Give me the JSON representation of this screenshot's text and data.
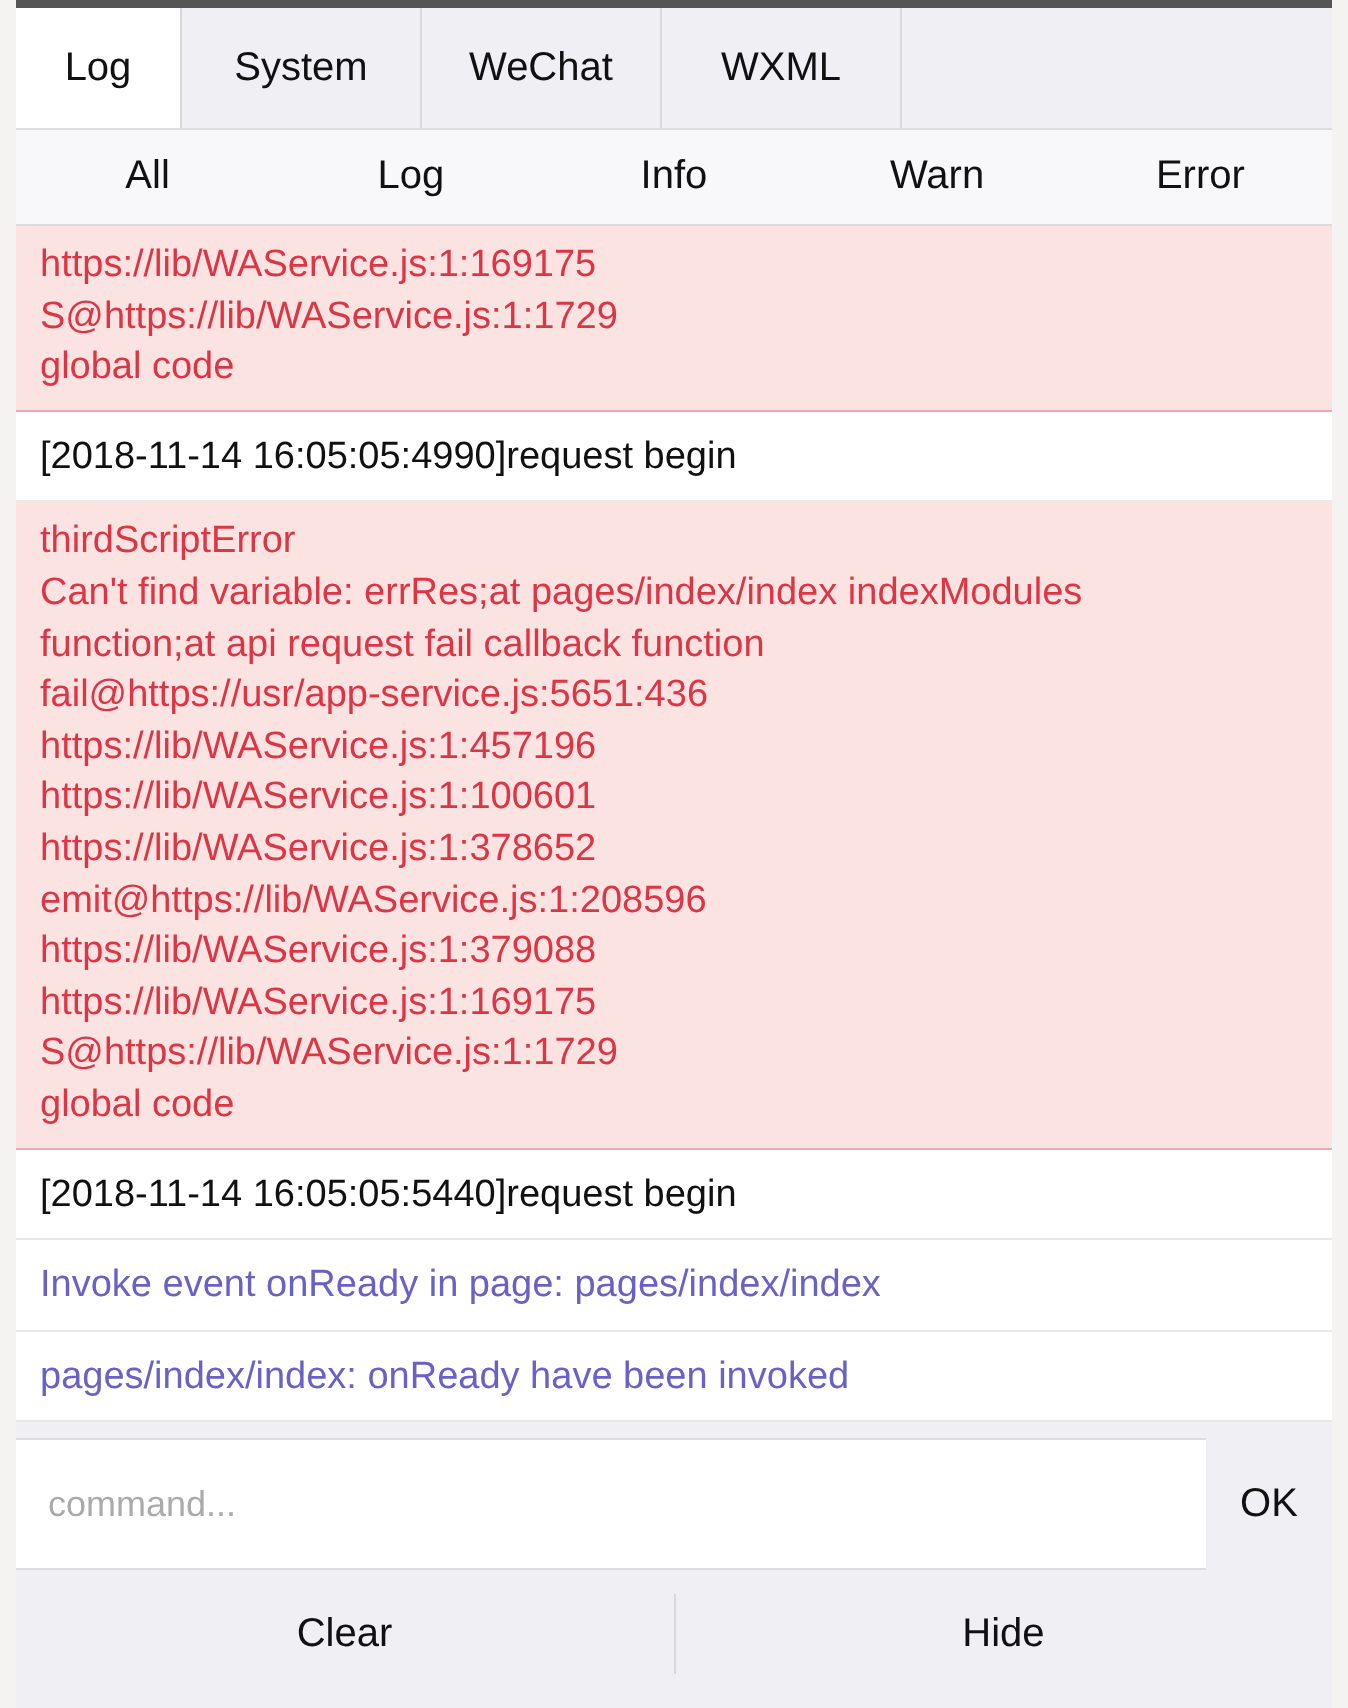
{
  "tabs": [
    {
      "label": "Log",
      "selected": true
    },
    {
      "label": "System",
      "selected": false
    },
    {
      "label": "WeChat",
      "selected": false
    },
    {
      "label": "WXML",
      "selected": false
    }
  ],
  "filters": [
    {
      "label": "All"
    },
    {
      "label": "Log"
    },
    {
      "label": "Info"
    },
    {
      "label": "Warn"
    },
    {
      "label": "Error"
    }
  ],
  "entries": [
    {
      "kind": "error",
      "lines": [
        "https://lib/WAService.js:1:169175",
        "S@https://lib/WAService.js:1:1729",
        "global code"
      ]
    },
    {
      "kind": "log",
      "lines": [
        "[2018-11-14 16:05:05:4990]request begin"
      ]
    },
    {
      "kind": "error",
      "lines": [
        "thirdScriptError",
        "Can't find variable: errRes;at pages/index/index indexModules function;at api request fail callback function",
        "fail@https://usr/app-service.js:5651:436",
        "https://lib/WAService.js:1:457196",
        "https://lib/WAService.js:1:100601",
        "https://lib/WAService.js:1:378652",
        "emit@https://lib/WAService.js:1:208596",
        "https://lib/WAService.js:1:379088",
        "https://lib/WAService.js:1:169175",
        "S@https://lib/WAService.js:1:1729",
        "global code"
      ]
    },
    {
      "kind": "log",
      "lines": [
        "[2018-11-14 16:05:05:5440]request begin"
      ]
    },
    {
      "kind": "info",
      "lines": [
        "Invoke event onReady in page: pages/index/index"
      ]
    },
    {
      "kind": "info",
      "lines": [
        "pages/index/index: onReady have been invoked"
      ]
    }
  ],
  "command": {
    "placeholder": "command...",
    "button": "OK"
  },
  "actions": [
    "Clear",
    "Hide"
  ]
}
